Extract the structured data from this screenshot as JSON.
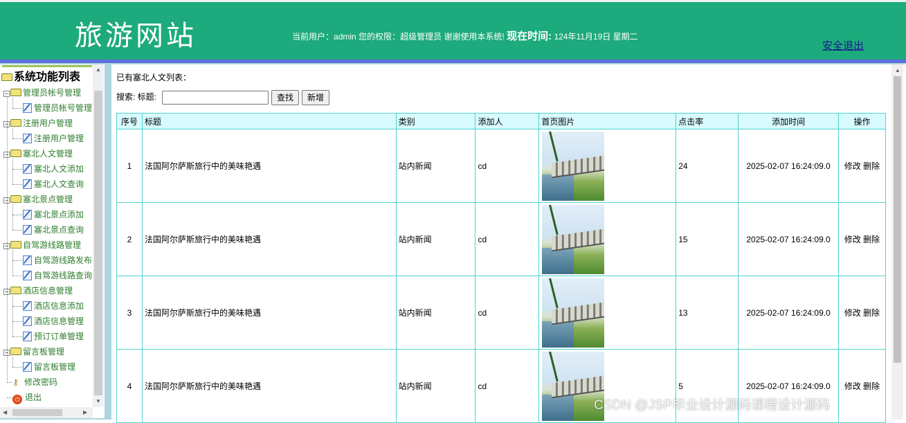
{
  "header": {
    "site_title": "旅游网站",
    "current_user_prefix": "当前用户：",
    "current_user": "admin",
    "permission_prefix": "您的权限：",
    "permission": "超级管理员",
    "thanks": "谢谢使用本系统!",
    "time_label": "现在时间:",
    "time_value": "124年11月19日 星期二",
    "logout_label": "安全退出"
  },
  "sidebar": {
    "root_label": "系统功能列表",
    "groups": [
      {
        "label": "管理员帐号管理",
        "items": [
          "管理员帐号管理"
        ]
      },
      {
        "label": "注册用户管理",
        "items": [
          "注册用户管理"
        ]
      },
      {
        "label": "塞北人文管理",
        "items": [
          "塞北人文添加",
          "塞北人文查询"
        ]
      },
      {
        "label": "塞北景点管理",
        "items": [
          "塞北景点添加",
          "塞北景点查询"
        ]
      },
      {
        "label": "自驾游线路管理",
        "items": [
          "自驾游线路发布",
          "自驾游线路查询"
        ]
      },
      {
        "label": "酒店信息管理",
        "items": [
          "酒店信息添加",
          "酒店信息管理",
          "预订订单管理"
        ]
      },
      {
        "label": "留言板管理",
        "items": [
          "留言板管理"
        ]
      }
    ],
    "change_password": "修改密码",
    "exit": "退出"
  },
  "main": {
    "list_title": "已有塞北人文列表：",
    "search_label": "搜索: 标题:",
    "search_value": "",
    "search_button": "查找",
    "add_button": "新增",
    "columns": [
      "序号",
      "标题",
      "类别",
      "添加人",
      "首页图片",
      "点击率",
      "添加时间",
      "操作"
    ],
    "rows": [
      {
        "no": "1",
        "title": "法国阿尔萨斯旅行中的美味艳遇",
        "category": "站内新闻",
        "author": "cd",
        "clicks": "24",
        "time": "2025-02-07 16:24:09.0",
        "edit": "修改",
        "delete": "删除"
      },
      {
        "no": "2",
        "title": "法国阿尔萨斯旅行中的美味艳遇",
        "category": "站内新闻",
        "author": "cd",
        "clicks": "15",
        "time": "2025-02-07 16:24:09.0",
        "edit": "修改",
        "delete": "删除"
      },
      {
        "no": "3",
        "title": "法国阿尔萨斯旅行中的美味艳遇",
        "category": "站内新闻",
        "author": "cd",
        "clicks": "13",
        "time": "2025-02-07 16:24:09.0",
        "edit": "修改",
        "delete": "删除"
      },
      {
        "no": "4",
        "title": "法国阿尔萨斯旅行中的美味艳遇",
        "category": "站内新闻",
        "author": "cd",
        "clicks": "5",
        "time": "2025-02-07 16:24:09.0",
        "edit": "修改",
        "delete": "删除"
      }
    ]
  },
  "watermark": "CSDN @JSP毕业设计源码课程设计源码",
  "colors": {
    "header_bg": "#1daa7d",
    "divider": "#5b6fe0",
    "frame_bg": "#add5df",
    "table_border": "#4fd2cc",
    "table_header_bg": "#d8fbff"
  },
  "icons": {
    "folder": "folder-open-icon",
    "page": "page-edit-icon",
    "password": "key-icon",
    "exit": "exit-icon"
  }
}
